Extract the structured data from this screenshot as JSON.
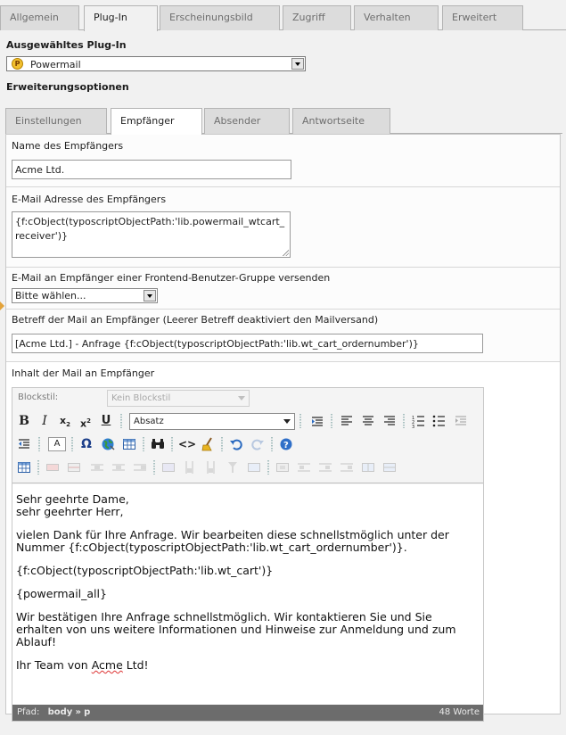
{
  "top_tabs": [
    "Allgemein",
    "Plug-In",
    "Erscheinungsbild",
    "Zugriff",
    "Verhalten",
    "Erweitert"
  ],
  "top_tabs_active": "Plug-In",
  "selected_plugin": {
    "label": "Ausgewähltes Plug-In",
    "value": "Powermail",
    "icon": "powermail-icon"
  },
  "extension_options_label": "Erweiterungsoptionen",
  "inner_tabs": [
    "Einstellungen",
    "Empfänger",
    "Absender",
    "Antwortseite"
  ],
  "inner_tabs_active": "Empfänger",
  "fields": {
    "receiver_name": {
      "label": "Name des Empfängers",
      "value": "Acme Ltd."
    },
    "receiver_email": {
      "label": "E-Mail Adresse des Empfängers",
      "value": "{f:cObject(typoscriptObjectPath:'lib.powermail_wtcart_receiver')}"
    },
    "frontend_group": {
      "label": "E-Mail an Empfänger einer Frontend-Benutzer-Gruppe versenden",
      "value": "Bitte wählen..."
    },
    "subject": {
      "label": "Betreff der Mail an Empfänger (Leerer Betreff deaktiviert den Mailversand)",
      "value": "[Acme Ltd.] - Anfrage {f:cObject(typoscriptObjectPath:'lib.wt_cart_ordernumber')}"
    },
    "body": {
      "label": "Inhalt der Mail an Empfänger"
    }
  },
  "rte": {
    "blockstil_label": "Blockstil:",
    "blockstil_value": "Kein Blockstil",
    "format_value": "Absatz",
    "content": {
      "greeting_1": "Sehr geehrte Dame,",
      "greeting_2": "sehr geehrter Herr,",
      "para_1a": "vielen Dank für Ihre Anfrage. Wir bearbeiten diese schnellstmöglich unter der",
      "para_1b": "Nummer {f:cObject(typoscriptObjectPath:'lib.wt_cart_ordernumber')}.",
      "para_2": "{f:cObject(typoscriptObjectPath:'lib.wt_cart')}",
      "para_3": "{powermail_all}",
      "para_4a": "Wir bestätigen Ihre Anfrage schnellstmöglich. Wir kontaktieren Sie und Sie",
      "para_4b": "erhalten von uns weitere Informationen und Hinweise zur Anmeldung und zum",
      "para_4c": "Ablauf!",
      "sign_prefix": "Ihr Team von ",
      "sign_company": "Acme",
      "sign_suffix": " Ltd!"
    },
    "status": {
      "path_label": "Pfad:",
      "path_body": "body",
      "path_sep": "»",
      "path_p": "p",
      "word_count": "48 Worte"
    }
  },
  "colors": {
    "status_bar": "#6c6c6c",
    "tab_inactive": "#dcdcdc",
    "marker": "#e3a33b"
  }
}
